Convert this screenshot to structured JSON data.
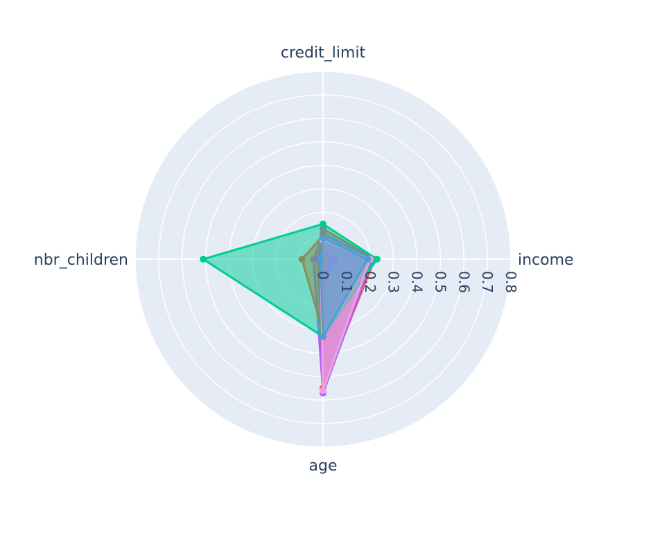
{
  "chart_data": {
    "type": "radar",
    "axes": [
      "income",
      "credit_limit",
      "nbr_children",
      "age"
    ],
    "radial_ticks": [
      "0",
      "0.1",
      "0.2",
      "0.3",
      "0.4",
      "0.5",
      "0.6",
      "0.7",
      "0.8"
    ],
    "rmax": 0.8,
    "grid": true,
    "legend": "none",
    "series": [
      {
        "color": "#EF553B",
        "values": [
          0.22,
          0.13,
          0.02,
          0.55
        ]
      },
      {
        "color": "#AB63FA",
        "values": [
          0.21,
          0.11,
          0.04,
          0.57
        ]
      },
      {
        "color": "#00CC96",
        "values": [
          0.23,
          0.15,
          0.51,
          0.33
        ]
      },
      {
        "color": "#636EFA",
        "values": [
          0.05,
          0.03,
          0.02,
          0.1
        ]
      },
      {
        "color": "#8C8C5A",
        "values": [
          0.01,
          0.1,
          0.09,
          0.31
        ]
      },
      {
        "color": "#F0A0E0",
        "values": [
          0.2,
          0.08,
          0.01,
          0.56
        ]
      },
      {
        "color": "#4C9ED9",
        "values": [
          0.19,
          0.09,
          0.01,
          0.33
        ]
      }
    ]
  }
}
